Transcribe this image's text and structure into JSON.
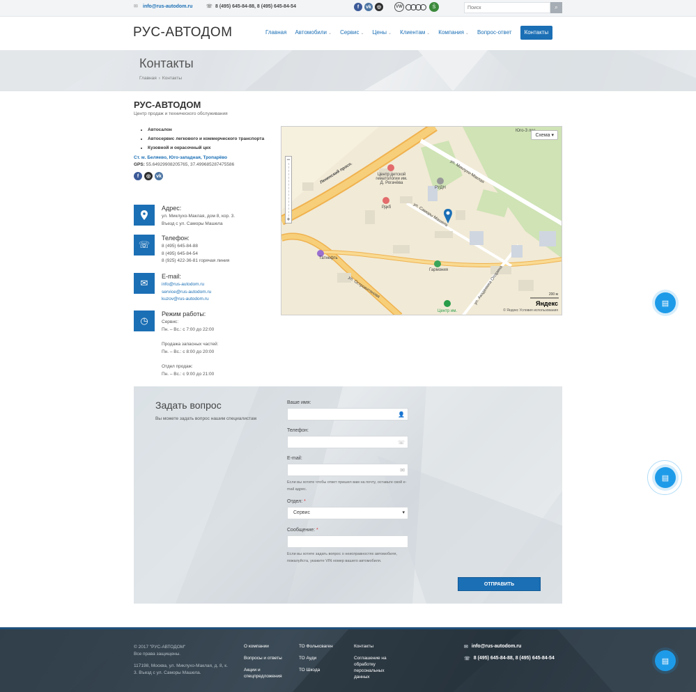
{
  "topbar": {
    "email": "info@rus-autodom.ru",
    "phones": "8 (495) 645-84-88, 8 (495) 645-84-54",
    "search_placeholder": "Поиск",
    "vw_label": "VW",
    "skoda_label": "Š"
  },
  "header": {
    "logo": "РУС-АВТОДОМ",
    "nav": [
      {
        "label": "Главная",
        "has_dropdown": false
      },
      {
        "label": "Автомобили",
        "has_dropdown": true
      },
      {
        "label": "Сервис",
        "has_dropdown": true
      },
      {
        "label": "Цены",
        "has_dropdown": true
      },
      {
        "label": "Клиентам",
        "has_dropdown": true
      },
      {
        "label": "Компания",
        "has_dropdown": true
      },
      {
        "label": "Вопрос-ответ",
        "has_dropdown": false
      },
      {
        "label": "Контакты",
        "has_dropdown": false,
        "active": true
      }
    ]
  },
  "banner": {
    "title": "Контакты",
    "breadcrumb_home": "Главная",
    "breadcrumb_sep": "›",
    "breadcrumb_current": "Контакты"
  },
  "company": {
    "name": "РУС-АВТОДОМ",
    "tagline": "Центр продаж и технического обслуживания",
    "services": [
      "Автосалон",
      "Автосервис легкового и коммерческого транспорта",
      "Кузовной и окрасочный цех"
    ],
    "metro": "Ст. м. Беляево, Юго-западная, Тропарёво",
    "gps_label": "GPS:",
    "gps_value": "55.649299082057​65, 37.499685287475586"
  },
  "address": {
    "title": "Адрес:",
    "lines": [
      "ул. Миклухо-Маклая, дом 8, кор. 3.",
      "Въезд с ул. Саморы Машела"
    ]
  },
  "phone": {
    "title": "Телефон:",
    "lines": [
      "8 (495) 645-84-88",
      "8 (495) 645-84-54",
      "8 (925) 422-36-81 горячая линия"
    ]
  },
  "email": {
    "title": "E-mail:",
    "lines": [
      "info@rus-autodom.ru",
      "service@rus-autodom.ru",
      "kuzov@rus-autodom.ru"
    ]
  },
  "hours": {
    "title": "Режим работы:",
    "groups": [
      {
        "name": "Сервис:",
        "time": "Пн. – Вс.: с 7:00 до 22:00"
      },
      {
        "name": "Продажа запасных частей:",
        "time": "Пн. – Вс.: с 8:00 до 20:00"
      },
      {
        "name": "Отдел продаж:",
        "time": "Пн. – Вс.: с 9:00 до 21:00"
      }
    ]
  },
  "map": {
    "scheme_button": "Схема ▾",
    "labels": {
      "leninsky": "Ленинский просп.",
      "miklukho": "ул. Миклухо-Маклая",
      "samory": "ул. Саморы Машела",
      "ostrovityanova": "ул. Островитянова",
      "akademika": "ул. Академика Опарина",
      "hematology": "Центр детской гематологии им. Д. Рогачёва",
      "rudn": "РУДН",
      "rdkb": "Рдкб",
      "tatneft": "Татнефть",
      "garmonia": "Гармония",
      "center": "Центр им.",
      "yugo": "Юго-З лес"
    },
    "scale": "200 м",
    "yandex": "Яндекс",
    "copyright": "© Яндекс  Условия использования",
    "zoom_plus": "+",
    "zoom_minus": "−"
  },
  "form": {
    "title": "Задать вопрос",
    "subtitle": "Вы можете задать вопрос нашим специалистам",
    "name_label": "Ваше имя:",
    "phone_label": "Телефон:",
    "email_label": "E-mail:",
    "email_hint": "Если вы хотите чтобы ответ пришел вам на почту, оставьте свой e-mail адрес.",
    "dept_label": "Отдел:",
    "dept_value": "Сервис",
    "message_label": "Сообщение:",
    "message_hint": "Если вы хотите задать вопрос о неисправностях автомобиля, пожалуйста, укажите VIN номер вашего автомобиля.",
    "required_mark": "*",
    "submit": "ОТПРАВИТЬ"
  },
  "footer": {
    "copyright": "© 2017 \"РУС-АВТОДОМ\"",
    "rights": "Все права защищены.",
    "address": "117198, Москва, ул. Миклухо-Маклая, д. 8, к. 3. Въезд с ул. Саморы Машела.",
    "col1": [
      "О компании",
      "Вопросы и ответы",
      "Акции и спецпредложения"
    ],
    "col2": [
      "ТО Фольксваген",
      "ТО Ауди",
      "ТО Шкода"
    ],
    "col3": [
      "Контакты",
      "Соглашение на обработку персональных данных"
    ],
    "email": "info@rus-autodom.ru",
    "phones": "8 (495) 645-84-88, 8 (495) 645-84-54"
  },
  "colors": {
    "accent": "#1b6fb5",
    "fab": "#1e9be8",
    "footer_bg": "#2e3b46"
  }
}
